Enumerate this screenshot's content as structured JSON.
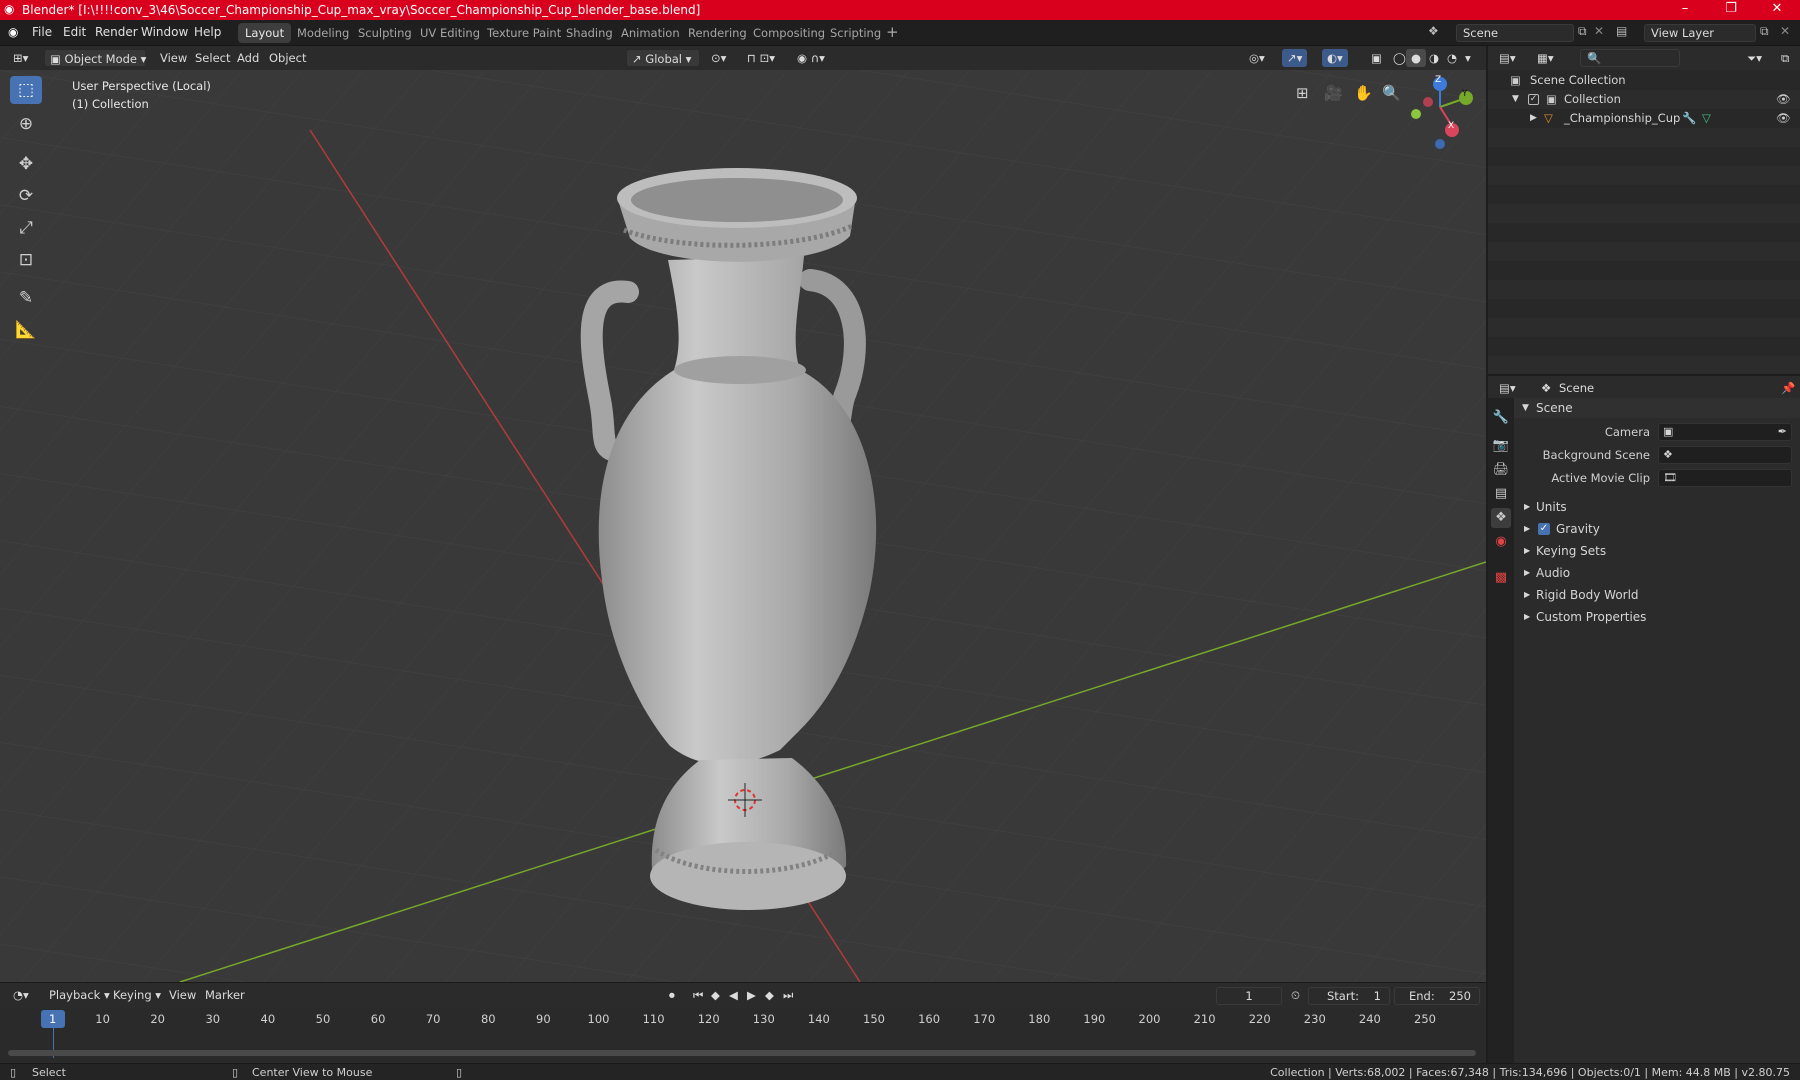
{
  "titlebar": {
    "title": "Blender* [I:\\!!!!conv_3\\46\\Soccer_Championship_Cup_max_vray\\Soccer_Championship_Cup_blender_base.blend]",
    "minimize": "–",
    "maximize": "❐",
    "close": "✕",
    "color": "#d9001d"
  },
  "menu": {
    "file": "File",
    "edit": "Edit",
    "render": "Render",
    "window": "Window",
    "help": "Help"
  },
  "workspaces": [
    "Layout",
    "Modeling",
    "Sculpting",
    "UV Editing",
    "Texture Paint",
    "Shading",
    "Animation",
    "Rendering",
    "Compositing",
    "Scripting"
  ],
  "scene_selector": {
    "value": "Scene"
  },
  "view_layer": {
    "value": "View Layer"
  },
  "viewport_header": {
    "mode": "Object Mode",
    "view": "View",
    "select": "Select",
    "add": "Add",
    "object": "Object",
    "transform_orientation": "Global"
  },
  "viewport": {
    "perspective_label": "User Perspective (Local)",
    "collection_label": "(1) Collection",
    "gizmo": {
      "x": "X",
      "y": "Y",
      "z": "Z"
    },
    "grid_x_color": "#b23b3b",
    "grid_y_color": "#76a82a"
  },
  "outliner": {
    "search_placeholder": "",
    "scene_collection": "Scene Collection",
    "collection": "Collection",
    "object": "_Championship_Cup"
  },
  "properties": {
    "header": "Scene",
    "panel_title": "Scene",
    "camera_label": "Camera",
    "background_scene_label": "Background Scene",
    "active_movie_clip_label": "Active Movie Clip",
    "sections": [
      "Units",
      "Gravity",
      "Keying Sets",
      "Audio",
      "Rigid Body World",
      "Custom Properties"
    ]
  },
  "timeline": {
    "playback": "Playback",
    "keying": "Keying",
    "view": "View",
    "marker": "Marker",
    "current_frame": "1",
    "start_label": "Start:",
    "start": "1",
    "end_label": "End:",
    "end": "250",
    "ticks": [
      "1",
      "10",
      "20",
      "30",
      "40",
      "50",
      "60",
      "70",
      "80",
      "90",
      "100",
      "110",
      "120",
      "130",
      "140",
      "150",
      "160",
      "170",
      "180",
      "190",
      "200",
      "210",
      "220",
      "230",
      "240",
      "250"
    ]
  },
  "statusbar": {
    "select": "Select",
    "center_view": "Center View to Mouse",
    "stats": "Collection | Verts:68,002 | Faces:67,348 | Tris:134,696 | Objects:0/1 | Mem: 44.8 MB | v2.80.75"
  },
  "accent": "#4772b3"
}
